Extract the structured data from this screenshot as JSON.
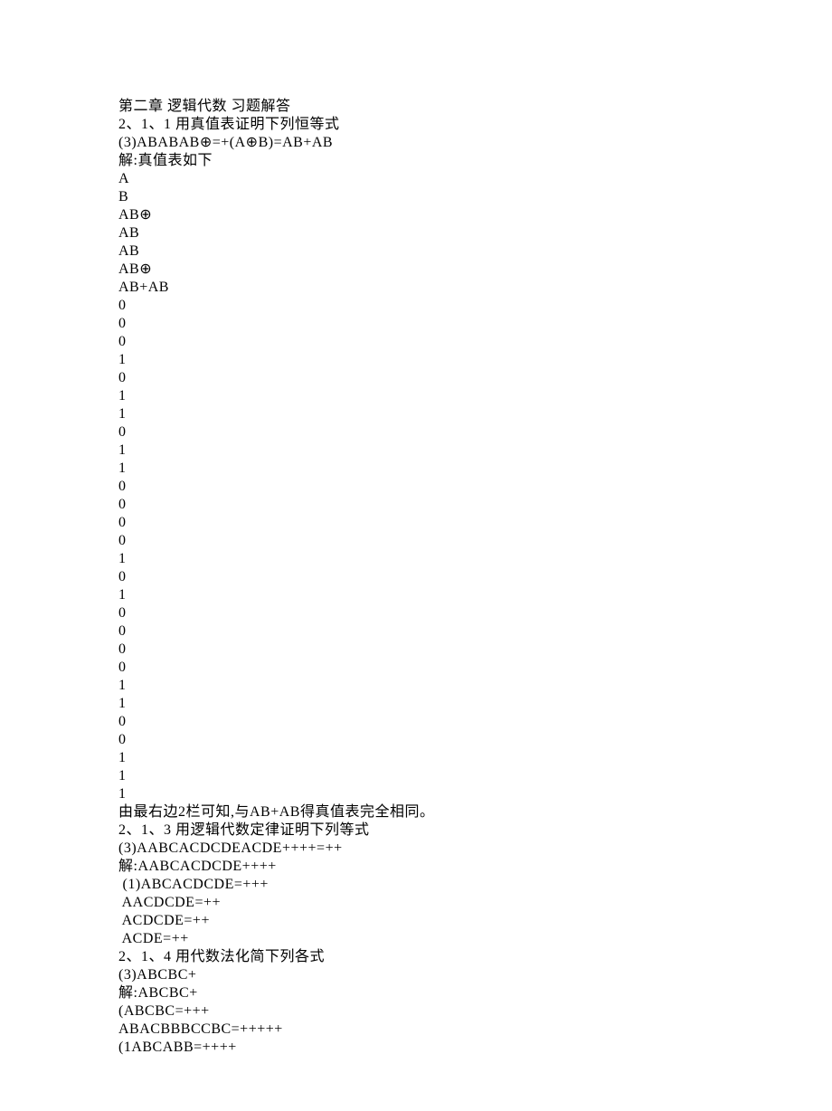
{
  "lines": [
    "第二章 逻辑代数 习题解答",
    "2、1、1 用真值表证明下列恒等式",
    "(3)ABABAB⊕=+(A⊕B)=AB+AB",
    "解:真值表如下",
    "A",
    "B",
    "AB⊕",
    "AB",
    "AB",
    "AB⊕",
    "AB+AB",
    "0",
    "0",
    "0",
    "1",
    "0",
    "1",
    "1",
    "0",
    "1",
    "1",
    "0",
    "0",
    "0",
    "0",
    "1",
    "0",
    "1",
    "0",
    "0",
    "0",
    "0",
    "1",
    "1",
    "0",
    "0",
    "1",
    "1",
    "1",
    "由最右边2栏可知,与AB+AB得真值表完全相同。",
    "2、1、3 用逻辑代数定律证明下列等式",
    "(3)AABCACDCDEACDE++++=++",
    "解:AABCACDCDE++++",
    " (1)ABCACDCDE=+++",
    " AACDCDE=++",
    " ACDCDE=++",
    " ACDE=++",
    "2、1、4 用代数法化简下列各式",
    "(3)ABCBC+",
    "解:ABCBC+",
    "(ABCBC=+++",
    "ABACBBBCCBC=+++++",
    "(1ABCABB=++++"
  ]
}
